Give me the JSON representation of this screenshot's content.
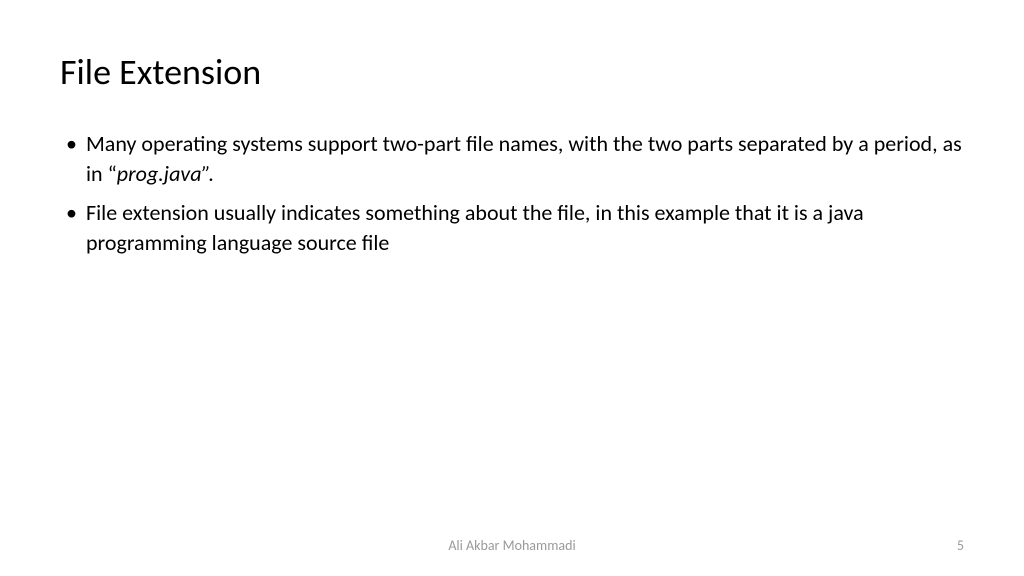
{
  "slide": {
    "title": "File Extension",
    "bullets": [
      {
        "pre": "Many operating systems support two-part file names, with the two parts separated by a period, as in “",
        "italic": "prog.java”.",
        "post": ""
      },
      {
        "pre": "File extension usually indicates something about the file, in this example that it is a java programming language source file",
        "italic": "",
        "post": ""
      }
    ],
    "footer": {
      "author": "Ali Akbar Mohammadi",
      "page": "5"
    }
  }
}
